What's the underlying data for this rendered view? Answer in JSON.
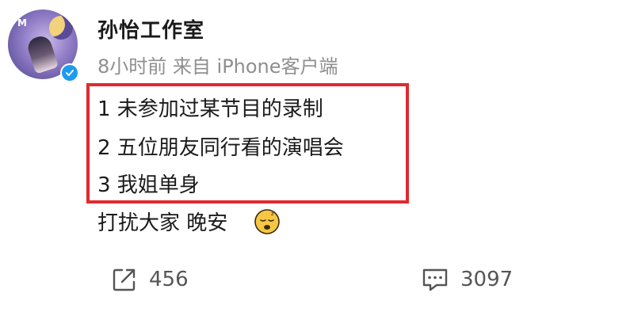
{
  "post": {
    "author": "孙怡工作室",
    "meta": "8小时前 来自 iPhone客户端",
    "lines": [
      "1 未参加过某节目的录制",
      "2 五位朋友同行看的演唱会",
      "3 我姐单身",
      "打扰大家 晚安"
    ],
    "emoji": "sleeping-face-emoji",
    "avatar_mark": "M"
  },
  "actions": {
    "repost": {
      "icon": "share-icon",
      "count": "456"
    },
    "comment": {
      "icon": "comment-icon",
      "count": "3097"
    }
  },
  "colors": {
    "highlight": "#e02a2e",
    "verified": "#1d9bf0",
    "meta_text": "#8f8f8f"
  }
}
